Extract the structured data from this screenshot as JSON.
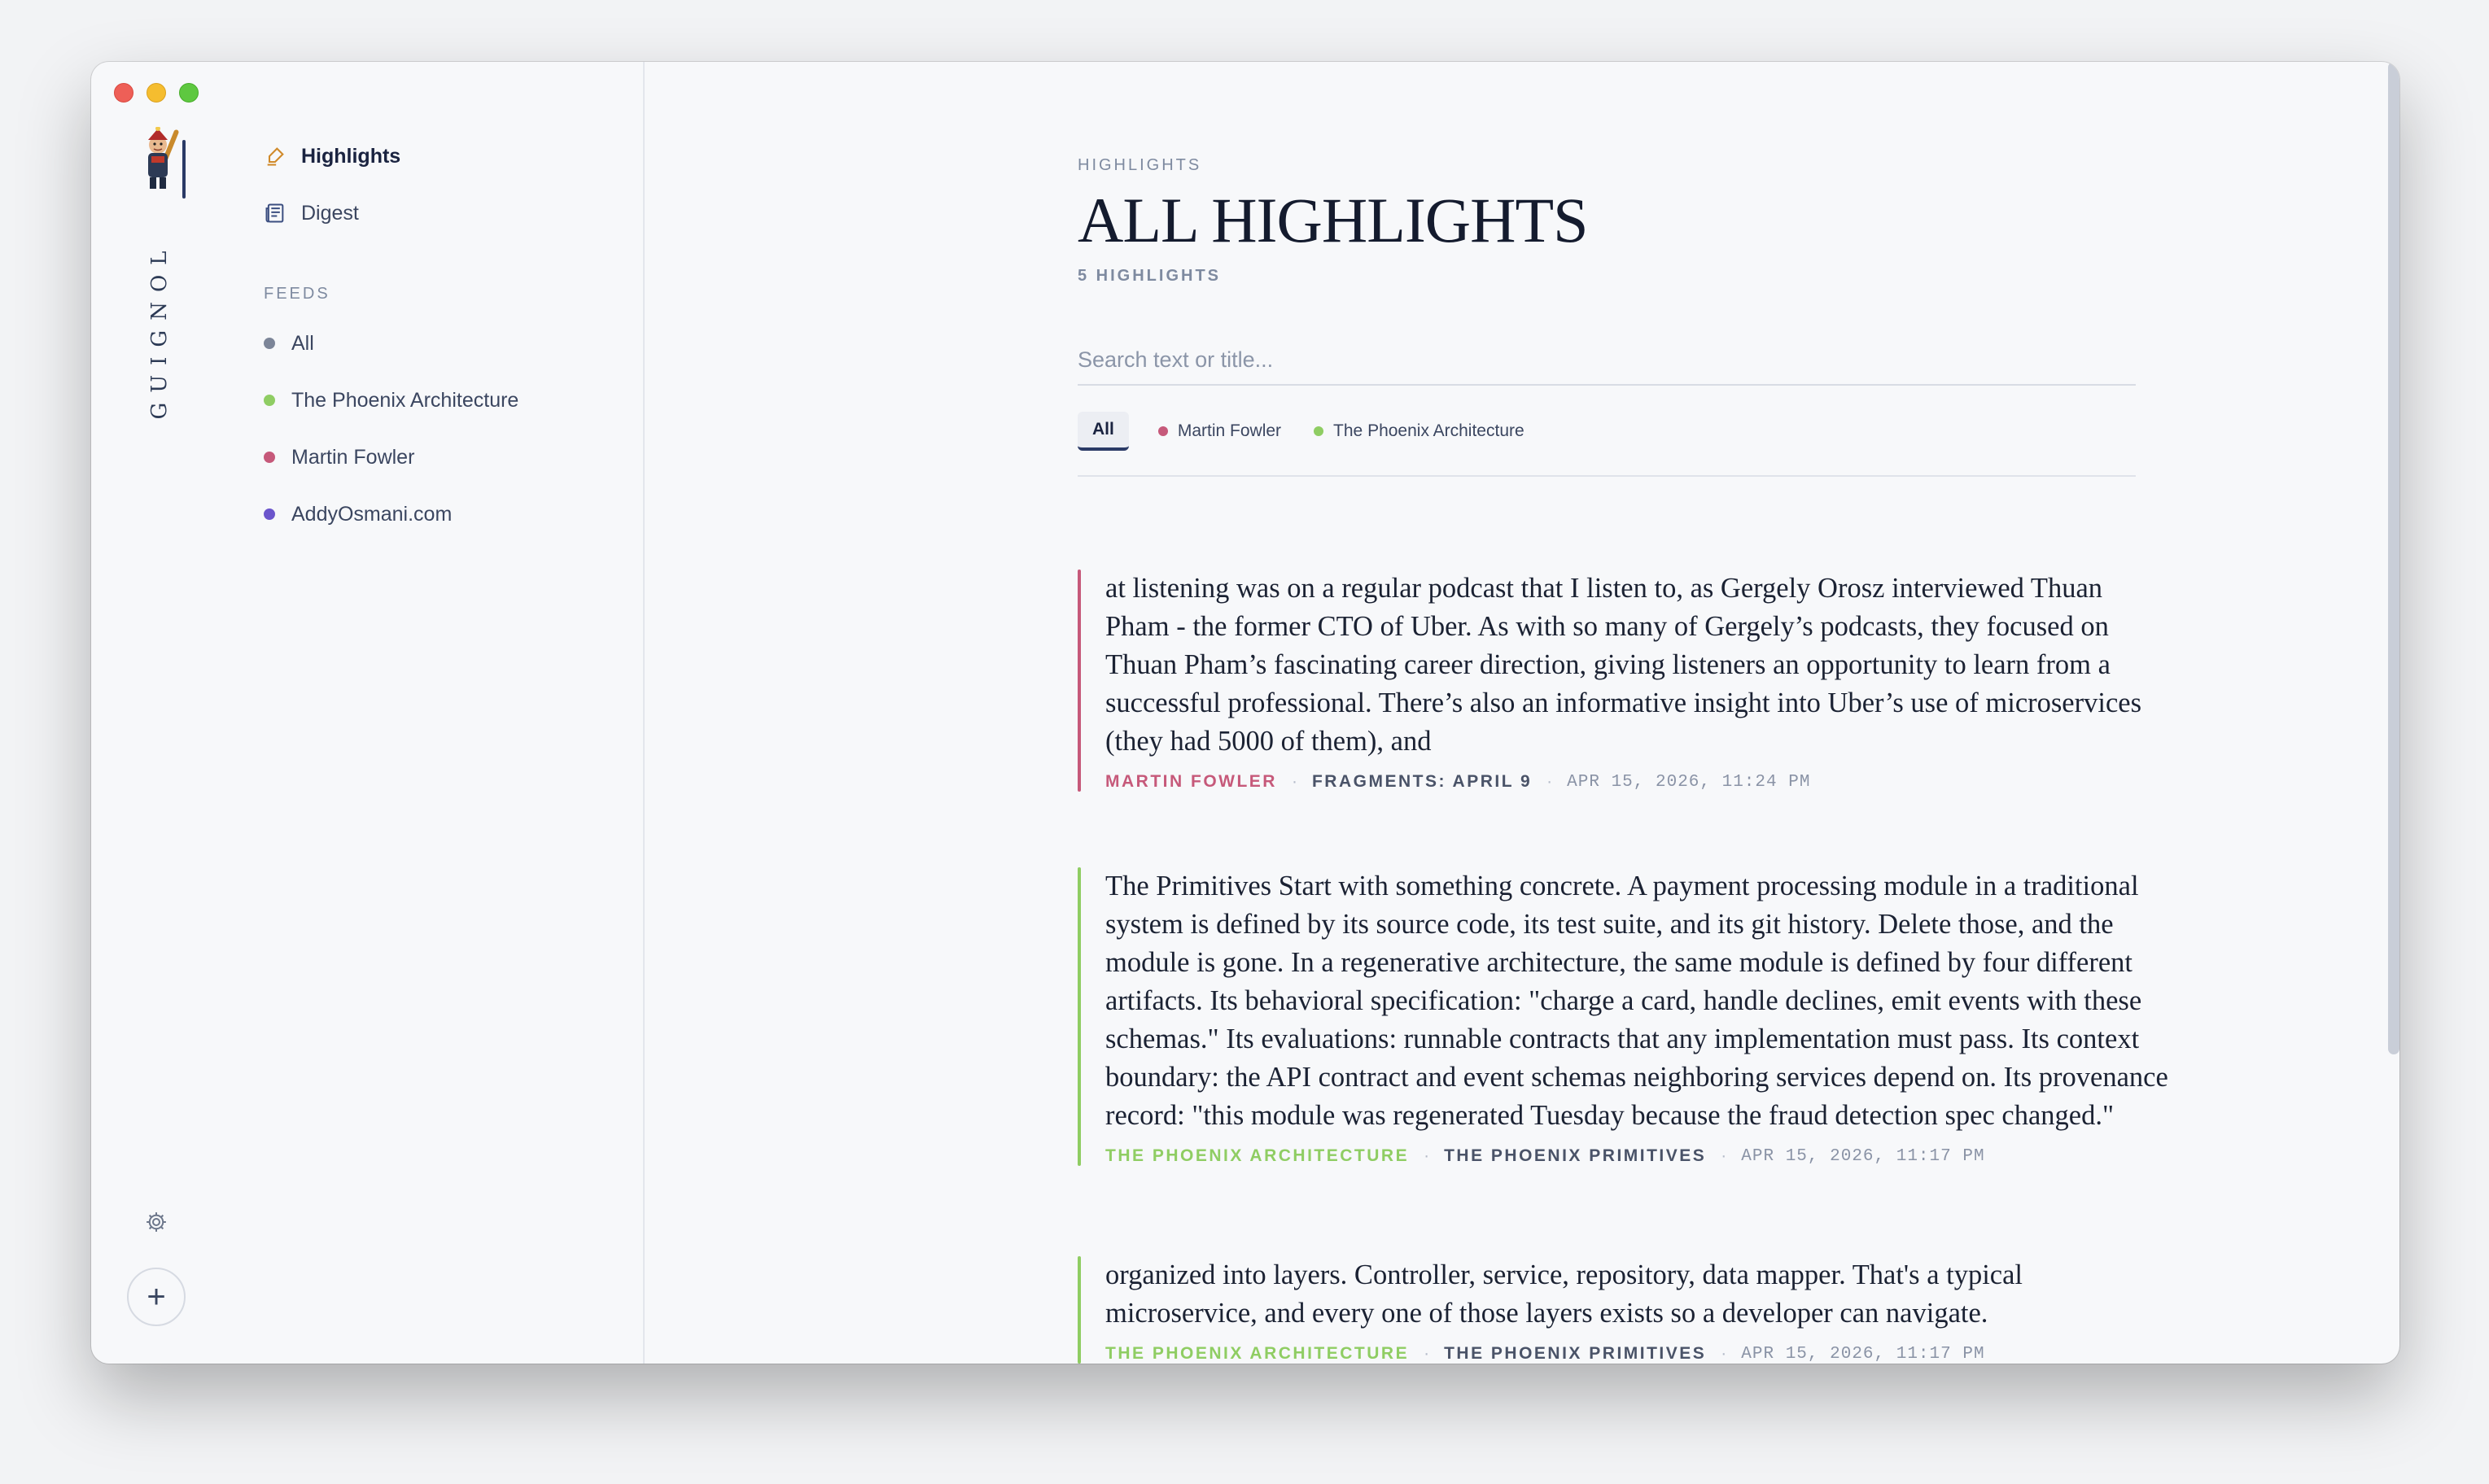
{
  "app": {
    "brand": "GUIGNOL"
  },
  "sidebar": {
    "nav": [
      {
        "label": "Highlights",
        "icon": "highlighter-icon",
        "active": true
      },
      {
        "label": "Digest",
        "icon": "newspaper-icon",
        "active": false
      }
    ],
    "feeds_label": "FEEDS",
    "feeds": [
      {
        "label": "All",
        "color": "#7c8598"
      },
      {
        "label": "The Phoenix Architecture",
        "color": "#8fcd63"
      },
      {
        "label": "Martin Fowler",
        "color": "#c6597a"
      },
      {
        "label": "AddyOsmani.com",
        "color": "#6b55cc"
      }
    ]
  },
  "main": {
    "eyebrow": "HIGHLIGHTS",
    "title": "ALL HIGHLIGHTS",
    "count": "5 HIGHLIGHTS",
    "search_placeholder": "Search text or title...",
    "filters": [
      {
        "label": "All",
        "active": true
      },
      {
        "label": "Martin Fowler",
        "color": "#c6597a"
      },
      {
        "label": "The Phoenix Architecture",
        "color": "#8fcd63"
      }
    ],
    "highlights": [
      {
        "text": "at listening was on a regular podcast that I listen to, as Gergely Orosz interviewed Thuan Pham - the former CTO of Uber. As with so many of Gergely’s podcasts, they focused on Thuan Pham’s fascinating career direction, giving listeners an opportunity to learn from a successful professional. There’s also an informative insight into Uber’s use of microservices (they had 5000 of them), and",
        "source": "MARTIN FOWLER",
        "article": "FRAGMENTS: APRIL 9",
        "date": "APR 15, 2026, 11:24 PM",
        "color": "#c6597a"
      },
      {
        "text": "The Primitives Start with something concrete. A payment processing module in a traditional system is defined by its source code, its test suite, and its git history. Delete those, and the module is gone. In a regenerative architecture, the same module is defined by four different artifacts. Its behavioral specification: \"charge a card, handle declines, emit events with these schemas.\" Its evaluations: runnable contracts that any implementation must pass. Its context boundary: the API contract and event schemas neighboring services depend on. Its provenance record: \"this module was regenerated Tuesday because the fraud detection spec changed.\"",
        "source": "THE PHOENIX ARCHITECTURE",
        "article": "THE PHOENIX PRIMITIVES",
        "date": "APR 15, 2026, 11:17 PM",
        "color": "#8fcd63"
      },
      {
        "text": "organized into layers. Controller, service, repository, data mapper. That's a typical microservice, and every one of those layers exists so a developer can navigate.",
        "source": "THE PHOENIX ARCHITECTURE",
        "article": "THE PHOENIX PRIMITIVES",
        "date": "APR 15, 2026, 11:17 PM",
        "color": "#8fcd63"
      }
    ]
  }
}
